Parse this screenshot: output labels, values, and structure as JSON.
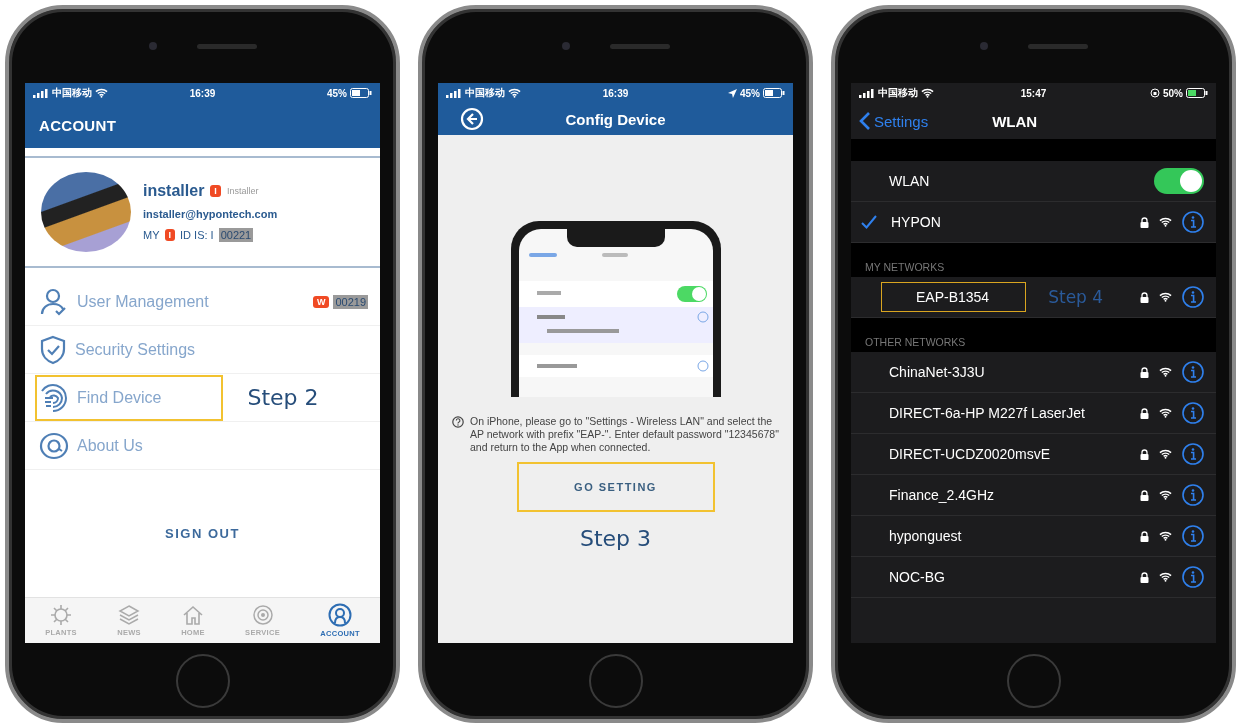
{
  "account_screen": {
    "status_bar": {
      "carrier": "中国移动",
      "time": "16:39",
      "battery": "45%"
    },
    "title": "ACCOUNT",
    "profile": {
      "name": "installer",
      "role_badge": "I",
      "role": "Installer",
      "email": "installer@hypontech.com",
      "id_prefix": "MY",
      "id_badge": "I",
      "id_label": "ID IS: I",
      "id_value": "00221"
    },
    "menu": [
      {
        "label": "User Management",
        "badge": "W",
        "value": "00219",
        "highlighted": false
      },
      {
        "label": "Security Settings",
        "highlighted": false
      },
      {
        "label": "Find Device",
        "highlighted": true
      },
      {
        "label": "About Us",
        "highlighted": false
      }
    ],
    "step_label": "Step 2",
    "sign_out": "SIGN OUT",
    "tabs": [
      {
        "label": "PLANTS",
        "selected": false
      },
      {
        "label": "NEWS",
        "selected": false
      },
      {
        "label": "HOME",
        "selected": false
      },
      {
        "label": "SERVICE",
        "selected": false
      },
      {
        "label": "ACCOUNT",
        "selected": true
      }
    ]
  },
  "config_screen": {
    "status_bar": {
      "carrier": "中国移动",
      "time": "16:39",
      "battery": "45%"
    },
    "title": "Config Device",
    "help_text": "On iPhone, please go to \"Settings - Wireless LAN\" and select the AP network with prefix \"EAP-\". Enter default password \"12345678\" and return to the App when connected.",
    "button": {
      "label": "GO SETTING",
      "highlighted": true
    },
    "step_label": "Step 3"
  },
  "wlan_screen": {
    "status_bar": {
      "carrier": "中国移动",
      "time": "15:47",
      "battery": "50%"
    },
    "back_label": "Settings",
    "title": "WLAN",
    "wlan_toggle": {
      "label": "WLAN",
      "on": true
    },
    "connected_network": {
      "name": "HYPON",
      "checked": true
    },
    "my_networks_header": "MY NETWORKS",
    "my_networks": [
      {
        "name": "EAP-B1354",
        "highlighted": true
      }
    ],
    "step_label": "Step 4",
    "other_networks_header": "OTHER NETWORKS",
    "other_networks": [
      {
        "name": "ChinaNet-3J3U"
      },
      {
        "name": "DIRECT-6a-HP M227f LaserJet"
      },
      {
        "name": "DIRECT-UCDZ0020msvE"
      },
      {
        "name": "Finance_2.4GHz"
      },
      {
        "name": "hyponguest"
      },
      {
        "name": "NOC-BG"
      }
    ]
  }
}
